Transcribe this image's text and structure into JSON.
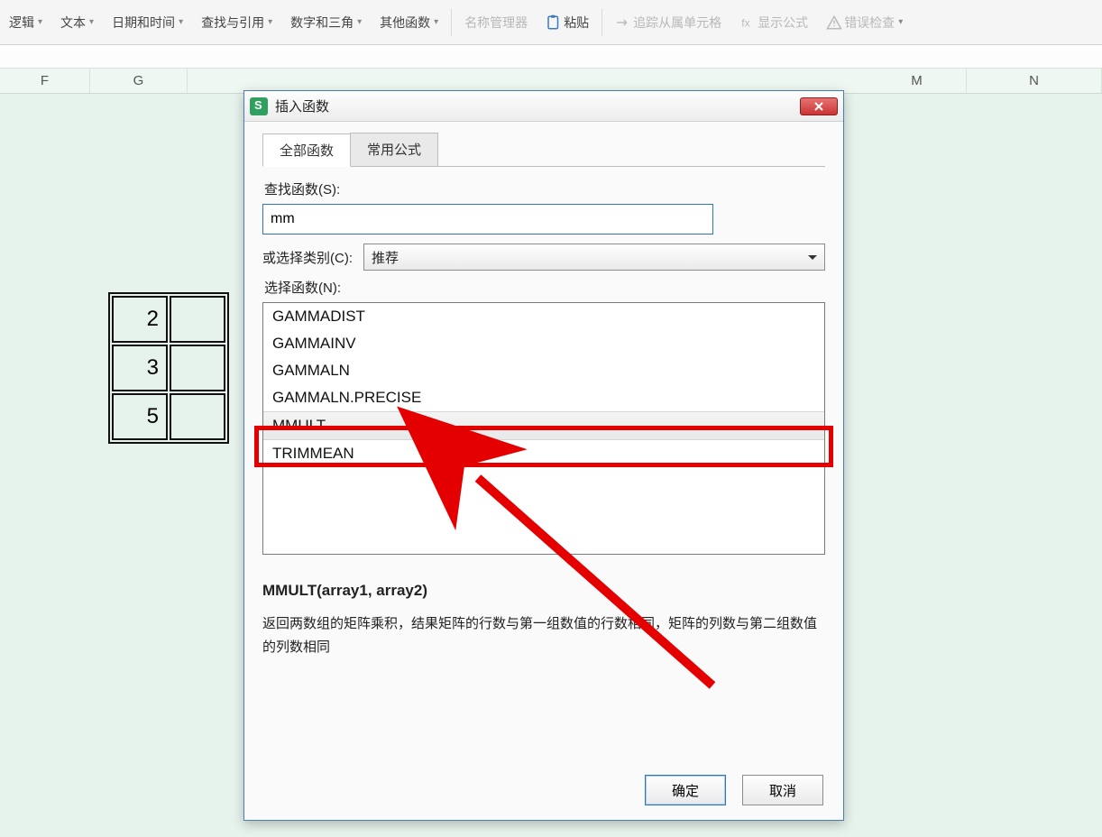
{
  "ribbon": {
    "items": [
      {
        "label": "逻辑",
        "disabled": false
      },
      {
        "label": "文本",
        "disabled": false
      },
      {
        "label": "日期和时间",
        "disabled": false
      },
      {
        "label": "查找与引用",
        "disabled": false
      },
      {
        "label": "数字和三角",
        "disabled": false
      },
      {
        "label": "其他函数",
        "disabled": false
      }
    ],
    "right": [
      {
        "label": "名称管理器",
        "disabled": true,
        "icon": "tag-icon"
      },
      {
        "label": "粘贴",
        "disabled": false,
        "icon": "paste-icon"
      },
      {
        "label": "追踪从属单元格",
        "disabled": true,
        "icon": "trace-icon"
      },
      {
        "label": "显示公式",
        "disabled": true,
        "icon": "formula-icon"
      },
      {
        "label": "错误检查",
        "disabled": true,
        "icon": "warning-icon"
      }
    ]
  },
  "columns": [
    "F",
    "G",
    "M",
    "N"
  ],
  "mini_table": {
    "rows": [
      [
        "2"
      ],
      [
        "3"
      ],
      [
        "5"
      ]
    ]
  },
  "dialog": {
    "title": "插入函数",
    "tabs": [
      "全部函数",
      "常用公式"
    ],
    "active_tab": 0,
    "search_label": "查找函数(S):",
    "search_value": "mm",
    "category_label": "或选择类别(C):",
    "category_value": "推荐",
    "list_label": "选择函数(N):",
    "functions": [
      "GAMMADIST",
      "GAMMAINV",
      "GAMMALN",
      "GAMMALN.PRECISE",
      "MMULT",
      "TRIMMEAN"
    ],
    "selected_index": 4,
    "desc_title": "MMULT(array1, array2)",
    "desc_text": "返回两数组的矩阵乘积，结果矩阵的行数与第一组数值的行数相同，矩阵的列数与第二组数值的列数相同",
    "ok": "确定",
    "cancel": "取消"
  }
}
